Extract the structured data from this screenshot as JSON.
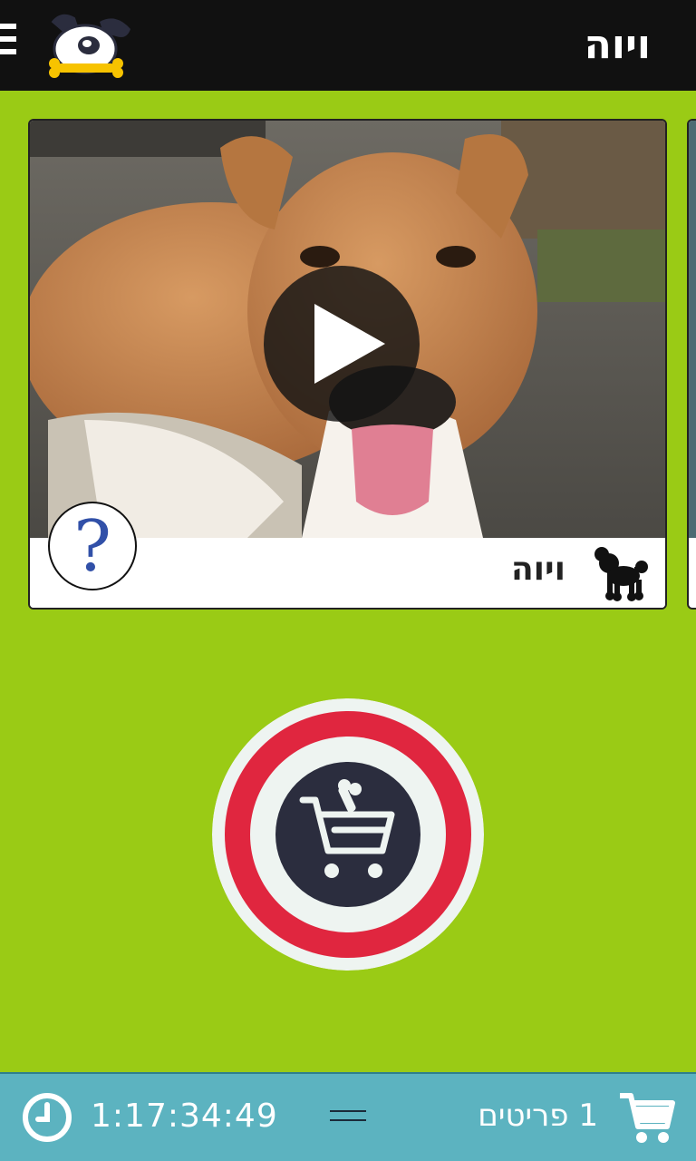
{
  "header": {
    "title": "ויוה",
    "menu_icon": "hamburger-icon",
    "logo": "dog-with-bone-logo"
  },
  "dog_card": {
    "name": "ויוה",
    "breed_icon": "poodle-icon",
    "help_symbol": "?",
    "media": "video"
  },
  "actions": {
    "add_to_cart_icon": "cart-with-bone-icon"
  },
  "footer": {
    "timer": "1:17:34:49",
    "items_count": "1 פריטים",
    "clock_icon": "clock-icon",
    "cart_icon": "cart-icon"
  },
  "colors": {
    "background": "#9acb15",
    "topbar": "#111111",
    "bottombar": "#5cb3c0",
    "ring_red": "#e0263f",
    "ring_light": "#eef4f1",
    "dark_navy": "#2b2d3e"
  }
}
